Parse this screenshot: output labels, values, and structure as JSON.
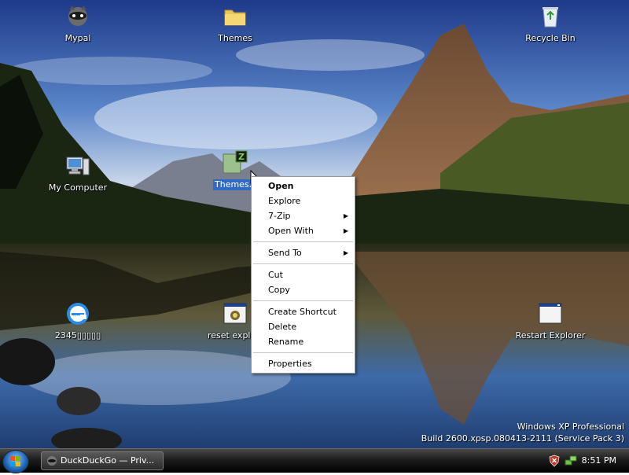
{
  "desktop": {
    "icons": [
      {
        "name": "mypal-icon",
        "label": "Mypal"
      },
      {
        "name": "themes-folder-icon",
        "label": "Themes"
      },
      {
        "name": "recycle-bin-icon",
        "label": "Recycle Bin"
      },
      {
        "name": "my-computer-icon",
        "label": "My Computer"
      },
      {
        "name": "themes-7z-icon",
        "label": "Themes.7z"
      },
      {
        "name": "browser-2345-icon",
        "label": "2345▯▯▯▯▯"
      },
      {
        "name": "reset-explorer-icon",
        "label": "reset explorer"
      },
      {
        "name": "restart-explorer-icon",
        "label": "Restart Explorer"
      }
    ]
  },
  "context_menu": {
    "items": [
      {
        "label": "Open",
        "bold": true,
        "submenu": false
      },
      {
        "label": "Explore",
        "bold": false,
        "submenu": false
      },
      {
        "label": "7-Zip",
        "bold": false,
        "submenu": true
      },
      {
        "label": "Open With",
        "bold": false,
        "submenu": true
      },
      {
        "separator": true
      },
      {
        "label": "Send To",
        "bold": false,
        "submenu": true
      },
      {
        "separator": true
      },
      {
        "label": "Cut",
        "bold": false,
        "submenu": false
      },
      {
        "label": "Copy",
        "bold": false,
        "submenu": false
      },
      {
        "separator": true
      },
      {
        "label": "Create Shortcut",
        "bold": false,
        "submenu": false
      },
      {
        "label": "Delete",
        "bold": false,
        "submenu": false
      },
      {
        "label": "Rename",
        "bold": false,
        "submenu": false
      },
      {
        "separator": true
      },
      {
        "label": "Properties",
        "bold": false,
        "submenu": false
      }
    ],
    "submenu_arrow": "▶"
  },
  "watermark": {
    "line1": "Windows XP Professional",
    "line2": "Build 2600.xpsp.080413-2111 (Service Pack 3)"
  },
  "taskbar": {
    "task_label": "DuckDuckGo — Priv...",
    "clock": "8:51 PM"
  },
  "colors": {
    "selection": "#316ac5",
    "taskbar": "#1c1c1c",
    "menu_background": "#ffffff"
  }
}
